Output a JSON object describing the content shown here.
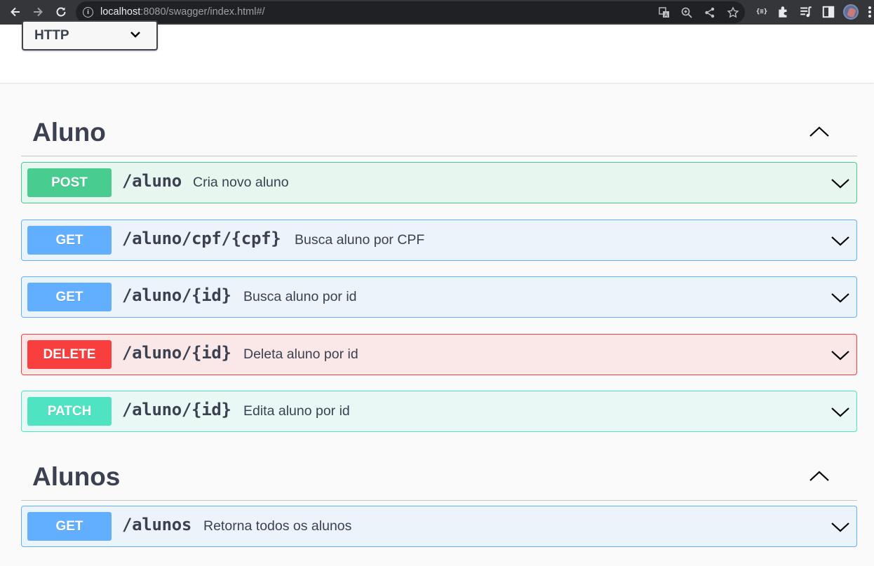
{
  "browser": {
    "url_host": "localhost",
    "url_path": ":8080/swagger/index.html#/",
    "info_symbol": "i",
    "extension_label": "{≡}"
  },
  "scheme_select": {
    "value": "HTTP"
  },
  "sections": [
    {
      "title": "Aluno",
      "operations": [
        {
          "method": "POST",
          "path": "/aluno",
          "summary": "Cria novo aluno"
        },
        {
          "method": "GET",
          "path": "/aluno/cpf/{cpf}",
          "summary": "Busca aluno por CPF"
        },
        {
          "method": "GET",
          "path": "/aluno/{id}",
          "summary": "Busca aluno por id"
        },
        {
          "method": "DELETE",
          "path": "/aluno/{id}",
          "summary": "Deleta aluno por id"
        },
        {
          "method": "PATCH",
          "path": "/aluno/{id}",
          "summary": "Edita aluno por id"
        }
      ]
    },
    {
      "title": "Alunos",
      "operations": [
        {
          "method": "GET",
          "path": "/alunos",
          "summary": "Retorna todos os alunos"
        }
      ]
    }
  ],
  "colors": {
    "post": "#49cc90",
    "get": "#61affe",
    "delete": "#f93e3e",
    "patch": "#50e3c2",
    "text": "#3b4151"
  },
  "icons": {
    "back": "arrow-left-icon",
    "forward": "arrow-right-icon",
    "reload": "reload-icon",
    "expand": "chevron-down-icon",
    "collapse": "chevron-up-icon"
  }
}
